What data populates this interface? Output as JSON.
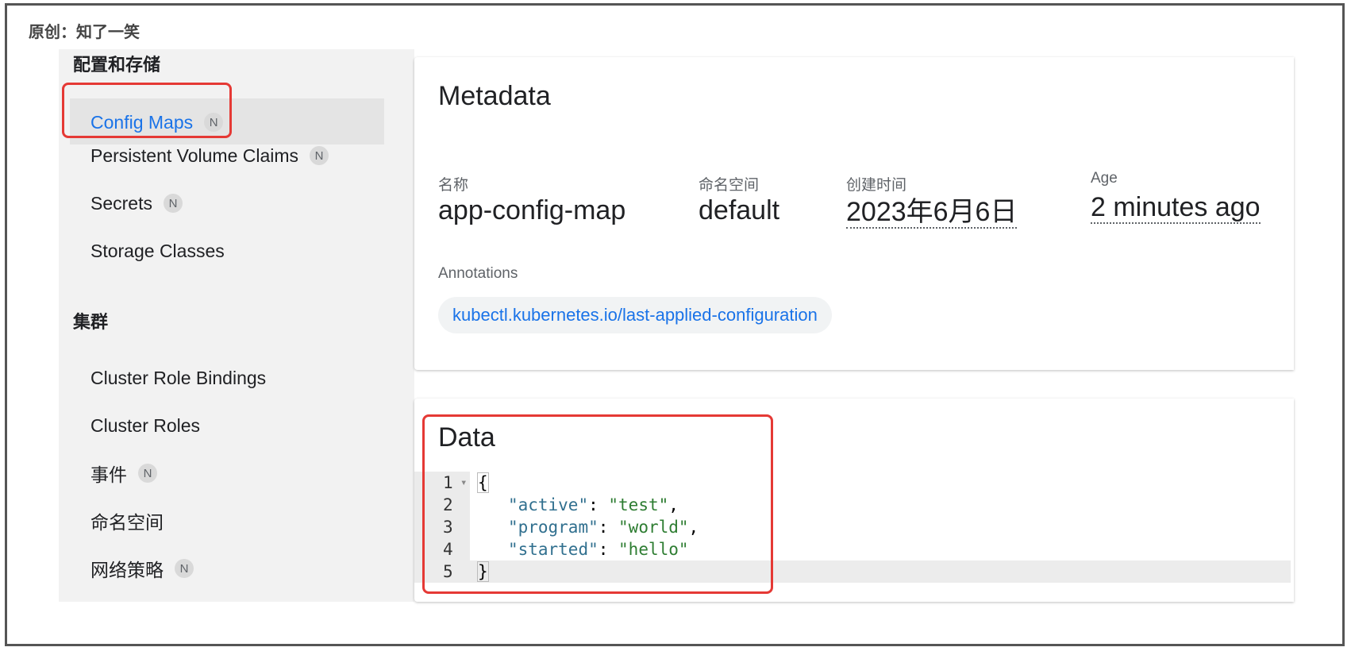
{
  "watermark": "原创：知了一笑",
  "sidebar": {
    "section_config": "配置和存储",
    "section_cluster": "集群",
    "badge": "N",
    "items": [
      {
        "label": "Config Maps"
      },
      {
        "label": "Persistent Volume Claims"
      },
      {
        "label": "Secrets"
      },
      {
        "label": "Storage Classes"
      },
      {
        "label": "Cluster Role Bindings"
      },
      {
        "label": "Cluster Roles"
      },
      {
        "label": "事件"
      },
      {
        "label": "命名空间"
      },
      {
        "label": "网络策略"
      }
    ]
  },
  "metadata": {
    "title": "Metadata",
    "name_label": "名称",
    "name_value": "app-config-map",
    "namespace_label": "命名空间",
    "namespace_value": "default",
    "created_label": "创建时间",
    "created_value": "2023年6月6日",
    "age_label": "Age",
    "age_value": "2 minutes ago",
    "annotations_label": "Annotations",
    "annotation_chip": "kubectl.kubernetes.io/last-applied-configuration"
  },
  "data_card": {
    "title": "Data",
    "lines": [
      {
        "num": "1",
        "open": "{"
      },
      {
        "num": "2",
        "key": "\"active\"",
        "sep": ": ",
        "value": "\"test\"",
        "trail": ","
      },
      {
        "num": "3",
        "key": "\"program\"",
        "sep": ": ",
        "value": "\"world\"",
        "trail": ","
      },
      {
        "num": "4",
        "key": "\"started\"",
        "sep": ": ",
        "value": "\"hello\"",
        "trail": ""
      },
      {
        "num": "5",
        "close": "}"
      }
    ]
  },
  "colors": {
    "accent": "#1a73e8",
    "highlight_box": "#e53935",
    "json_key": "#31708f",
    "json_string": "#2e7d32"
  }
}
